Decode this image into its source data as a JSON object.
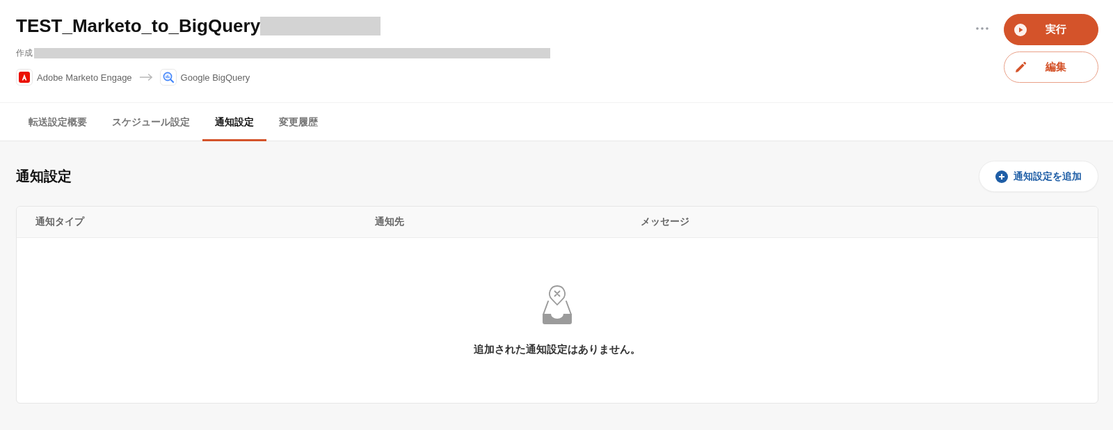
{
  "header": {
    "title": "TEST_Marketo_to_BigQuery",
    "title_redacted": true,
    "created_label": "作成",
    "created_redacted": true,
    "source": {
      "name": "Adobe Marketo Engage"
    },
    "destination": {
      "name": "Google BigQuery"
    }
  },
  "buttons": [
    {
      "label": "実行",
      "kind": "primary"
    },
    {
      "label": "編集",
      "kind": "outline"
    }
  ],
  "tabs": [
    {
      "label": "転送設定概要",
      "selected": false
    },
    {
      "label": "スケジュール設定",
      "selected": false
    },
    {
      "label": "通知設定",
      "selected": true
    },
    {
      "label": "変更履歴",
      "selected": false
    }
  ],
  "section": {
    "title": "通知設定",
    "add_button": "通知設定を追加"
  },
  "table": {
    "columns": [
      "通知タイプ",
      "通知先",
      "メッセージ"
    ],
    "empty_message": "追加された通知設定はありません。"
  }
}
